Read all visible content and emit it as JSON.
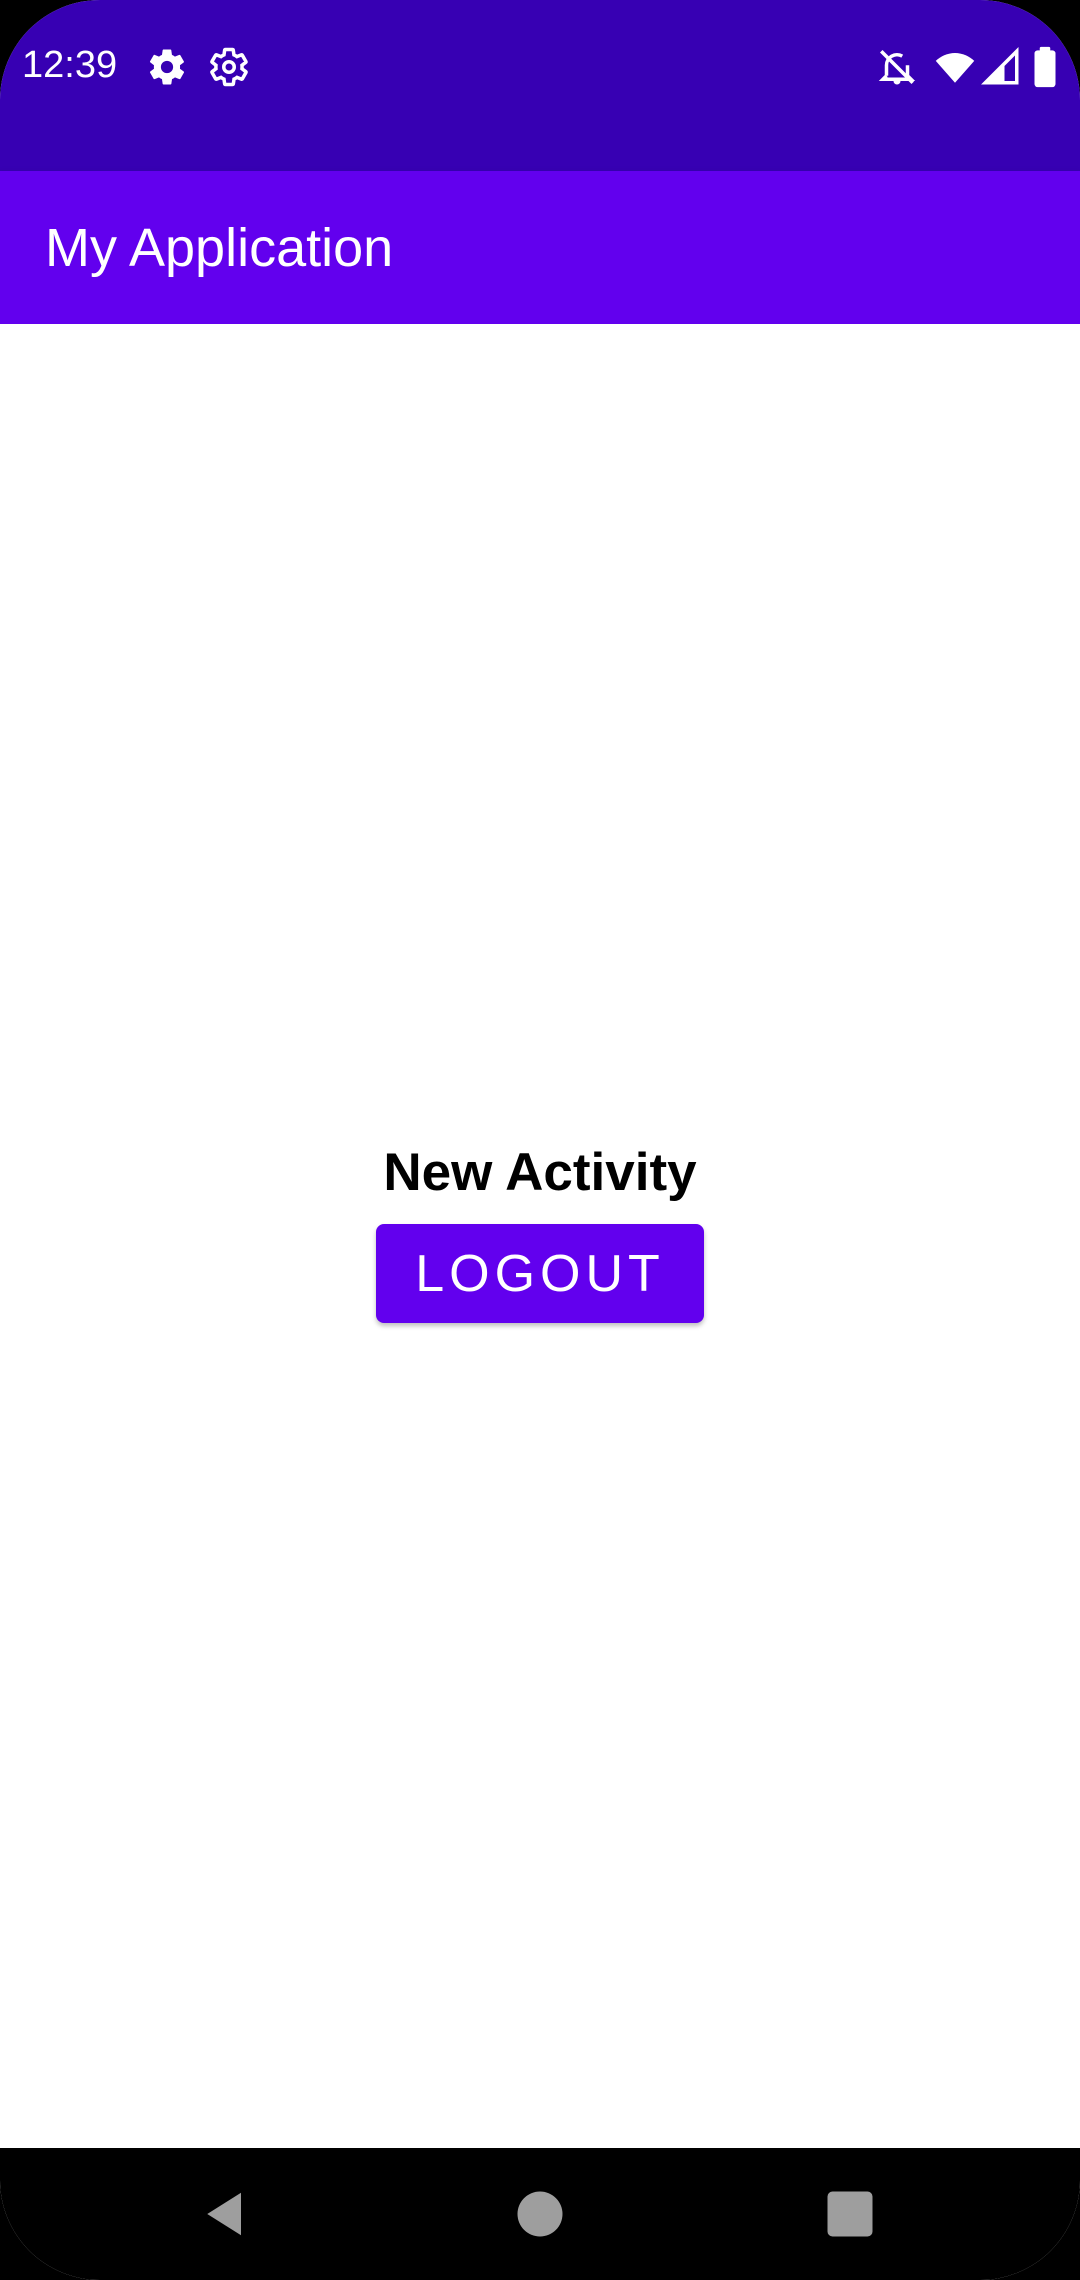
{
  "status_bar": {
    "time": "12:39",
    "icons_left": [
      "settings-gear-icon",
      "settings-outline-icon"
    ],
    "icons_right": [
      "notifications-off-icon",
      "wifi-icon",
      "cellular-signal-icon",
      "battery-icon"
    ],
    "background": "#3700b3"
  },
  "app_bar": {
    "title": "My Application",
    "background": "#6200ee"
  },
  "main": {
    "activity_label": "New Activity",
    "logout_label": "LOGOUT",
    "button_color": "#6200ee"
  },
  "nav_bar": {
    "buttons": [
      "back-icon",
      "home-icon",
      "recents-icon"
    ]
  }
}
